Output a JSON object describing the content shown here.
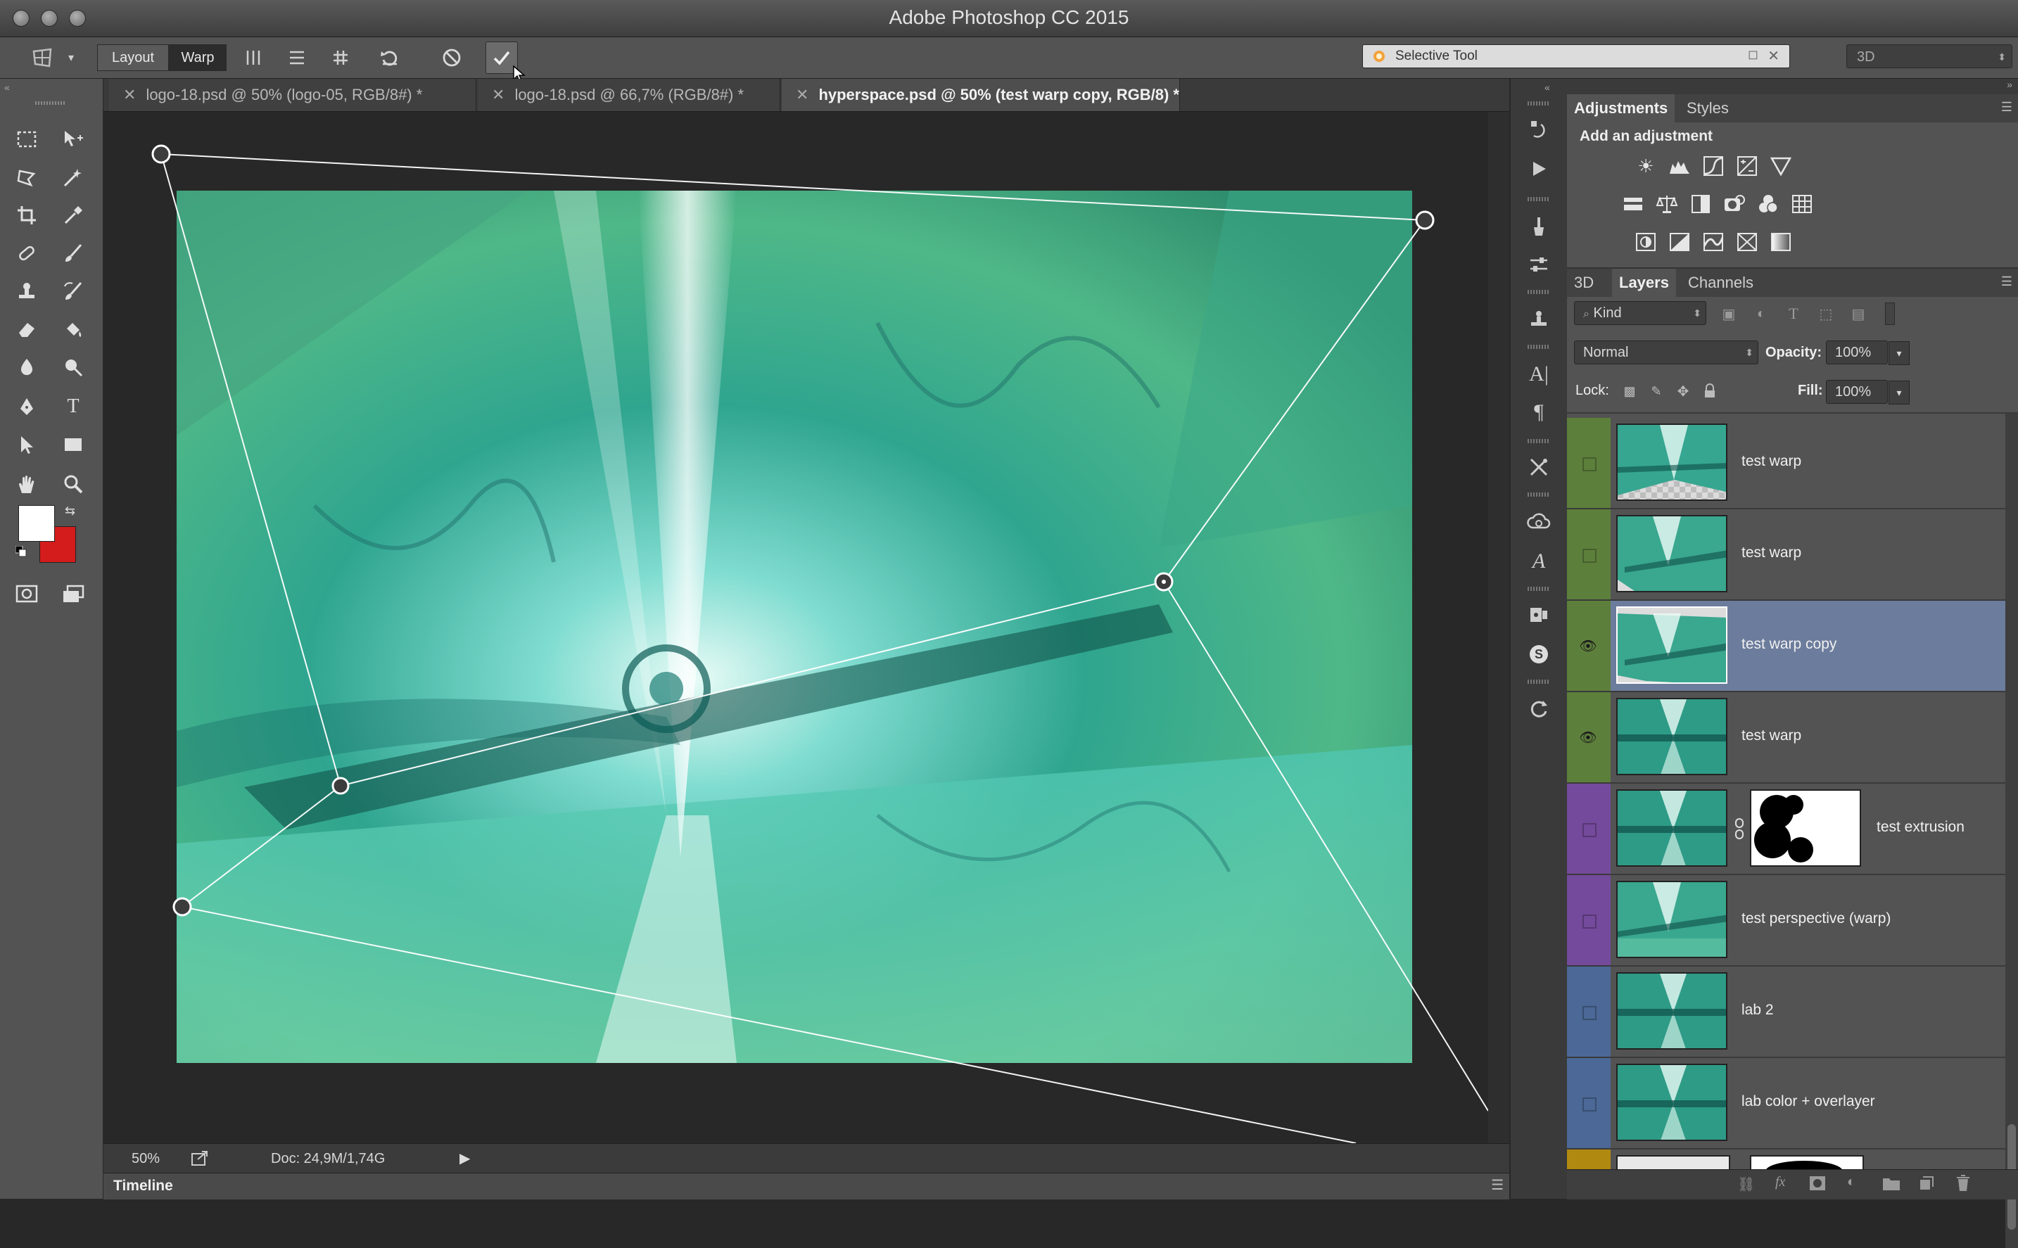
{
  "app": {
    "title": "Adobe Photoshop CC 2015"
  },
  "options_bar": {
    "layout_label": "Layout",
    "warp_label": "Warp",
    "search_placeholder": "Selective Tool",
    "workspace_value": "3D"
  },
  "tabs": [
    {
      "label": "logo-18.psd @ 50% (logo-05, RGB/8#) *"
    },
    {
      "label": "logo-18.psd @ 66,7% (RGB/8#) *"
    },
    {
      "label": "hyperspace.psd @ 50% (test warp copy, RGB/8) *"
    }
  ],
  "status": {
    "zoom": "50%",
    "doc": "Doc: 24,9M/1,74G"
  },
  "timeline": {
    "label": "Timeline"
  },
  "adjustments": {
    "tabs": [
      "Adjustments",
      "Styles"
    ],
    "heading": "Add an adjustment"
  },
  "layers_panel": {
    "tabs": [
      "3D",
      "Layers",
      "Channels"
    ],
    "filter_kind": "Kind",
    "blend_mode": "Normal",
    "opacity_label": "Opacity:",
    "opacity_value": "100%",
    "lock_label": "Lock:",
    "fill_label": "Fill:",
    "fill_value": "100%"
  },
  "layers": [
    {
      "name": "test warp",
      "visible": false,
      "color": "#5d7f3c",
      "selected": false
    },
    {
      "name": "test warp",
      "visible": false,
      "color": "#5d7f3c",
      "selected": false
    },
    {
      "name": "test warp copy",
      "visible": true,
      "color": "#5d7f3c",
      "selected": true
    },
    {
      "name": "test warp",
      "visible": true,
      "color": "#5d7f3c",
      "selected": false
    },
    {
      "name": "test extrusion",
      "visible": false,
      "color": "#744a9c",
      "selected": false
    },
    {
      "name": "test perspective (warp)",
      "visible": false,
      "color": "#744a9c",
      "selected": false
    },
    {
      "name": "lab 2",
      "visible": false,
      "color": "#4b6896",
      "selected": false
    },
    {
      "name": "lab color + overlayer",
      "visible": false,
      "color": "#4b6896",
      "selected": false
    }
  ],
  "colors": {
    "accent_selection": "#6c7c9c",
    "background_swatch": "#d41c1c",
    "foreground_swatch": "#ffffff",
    "image_teal": "#2fa58f"
  }
}
